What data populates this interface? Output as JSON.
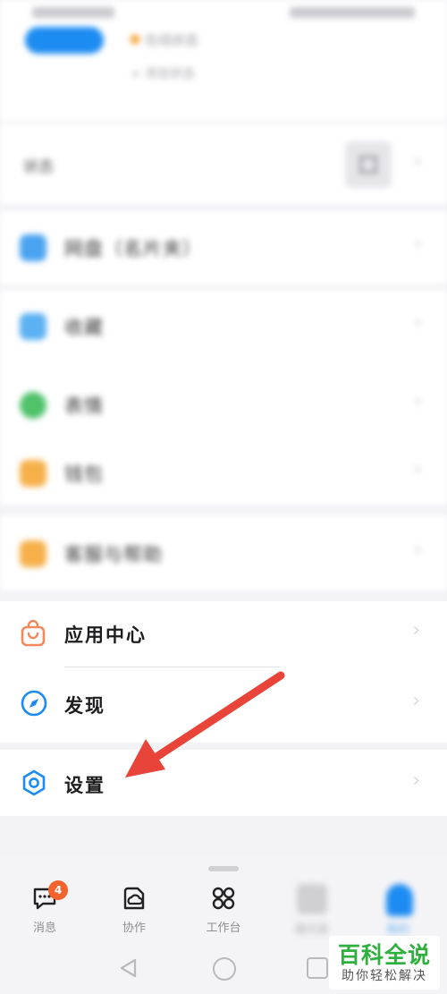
{
  "header": {
    "tag_text": "在线状态",
    "sub_text": "+ 添加状态"
  },
  "my_status": {
    "label": "状态"
  },
  "blurred_menu": [
    {
      "label": "网盘（名片夹）",
      "icon": "folder-icon",
      "color": "#4aa3f0"
    },
    {
      "label": "收藏",
      "icon": "bookmark-icon",
      "color": "#5bb1f2"
    },
    {
      "label": "表情",
      "icon": "emoji-icon",
      "color": "#4fc26a"
    },
    {
      "label": "钱包",
      "icon": "wallet-icon",
      "color": "#f6b04a"
    },
    {
      "label": "客服与帮助",
      "icon": "heart-hand-icon",
      "color": "#f6b04a"
    }
  ],
  "menu": {
    "app_center": "应用中心",
    "discover": "发现",
    "settings": "设置"
  },
  "colors": {
    "accent": "#1d8cf2",
    "app_center_icon": "#f08a5d",
    "arrow": "#e8443a",
    "badge": "#f5632d"
  },
  "tabs": [
    {
      "label": "消息",
      "badge": "4"
    },
    {
      "label": "协作"
    },
    {
      "label": "工作台"
    },
    {
      "label": "通讯录"
    },
    {
      "label": "我的"
    }
  ],
  "watermark": {
    "title": "百科全说",
    "subtitle": "助你轻松解决"
  }
}
